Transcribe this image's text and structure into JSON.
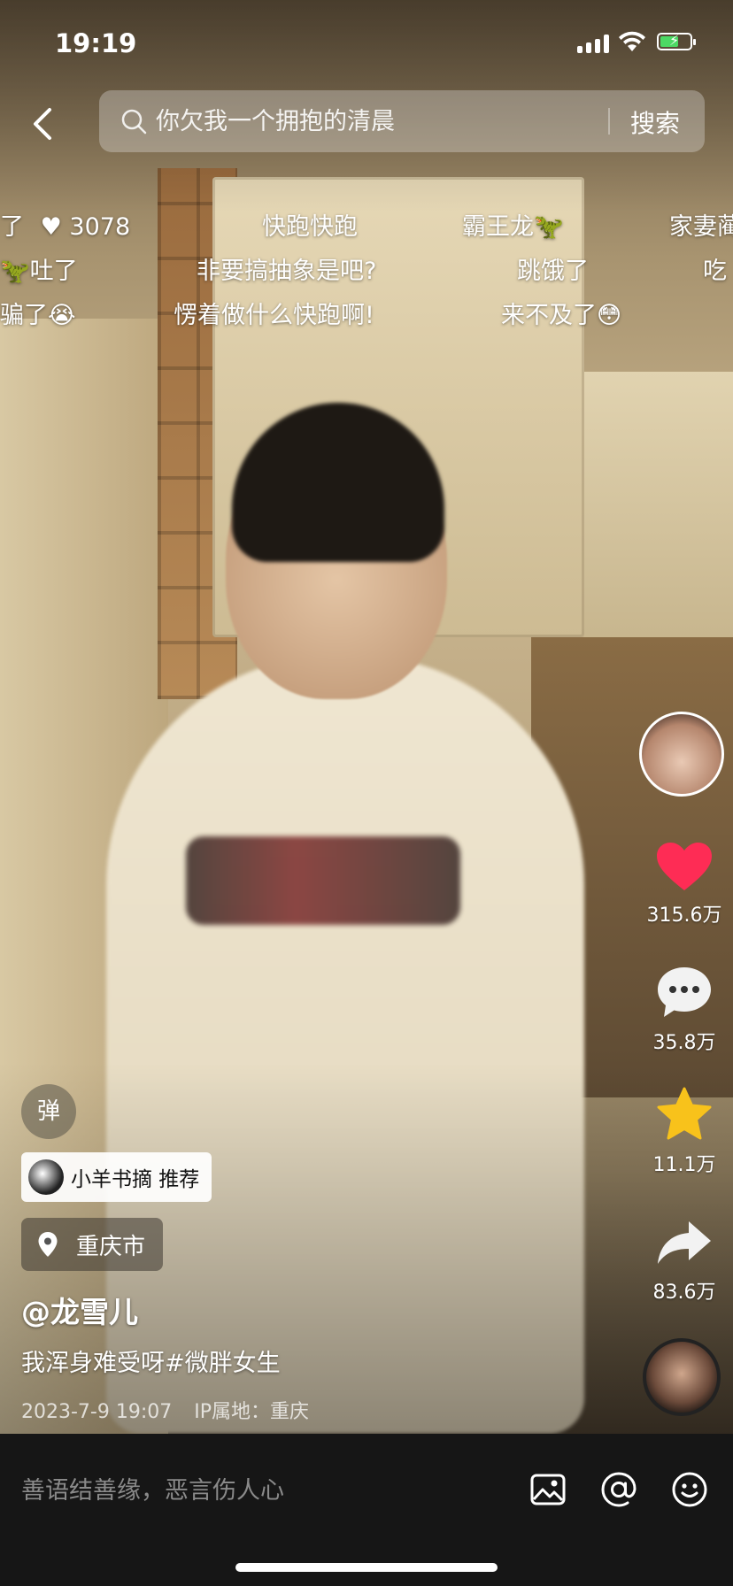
{
  "status_bar": {
    "time": "19:19"
  },
  "search": {
    "placeholder": "你欠我一个拥抱的清晨",
    "button_label": "搜索"
  },
  "danmaku": {
    "row1": [
      "了",
      "3078",
      "快跑快跑",
      "霸王龙🦖",
      "家妻蔺"
    ],
    "row2": [
      "🦖吐了",
      "非要搞抽象是吧?",
      "跳饿了",
      "吃"
    ],
    "row3": [
      "骗了😭",
      "愣着做什么快跑啊!",
      "来不及了😳"
    ]
  },
  "actions": {
    "likes": "315.6万",
    "comments": "35.8万",
    "favorites": "11.1万",
    "shares": "83.6万"
  },
  "danmaku_toggle_label": "弹",
  "recommend": {
    "label": "小羊书摘 推荐"
  },
  "location": {
    "label": "重庆市"
  },
  "video": {
    "author": "@龙雪儿",
    "caption": "我浑身难受呀#微胖女生",
    "date": "2023-7-9 19:07",
    "ip": "IP属地：重庆"
  },
  "comment_bar": {
    "placeholder": "善语结善缘，恶言伤人心"
  },
  "colors": {
    "like_red": "#fe2c55",
    "favorite_yellow": "#f8c21b"
  }
}
